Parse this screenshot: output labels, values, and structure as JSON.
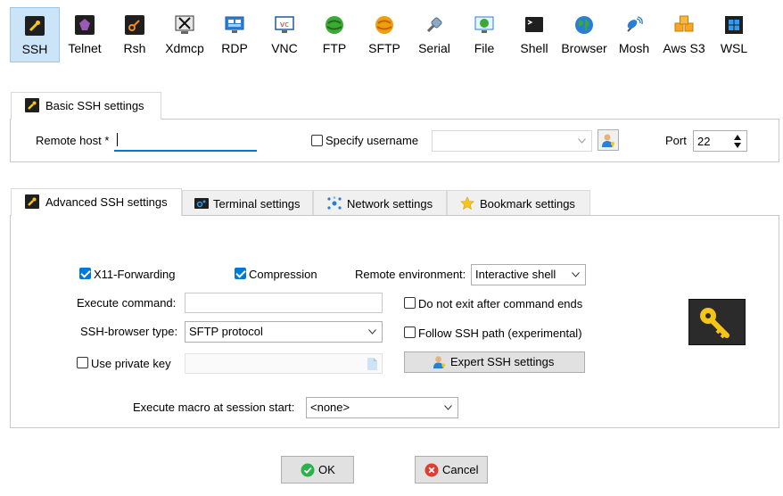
{
  "session_types": [
    {
      "label": "SSH",
      "icon": "ssh-icon",
      "active": true
    },
    {
      "label": "Telnet",
      "icon": "telnet-icon"
    },
    {
      "label": "Rsh",
      "icon": "rsh-icon"
    },
    {
      "label": "Xdmcp",
      "icon": "xdmcp-icon"
    },
    {
      "label": "RDP",
      "icon": "rdp-icon"
    },
    {
      "label": "VNC",
      "icon": "vnc-icon"
    },
    {
      "label": "FTP",
      "icon": "ftp-icon"
    },
    {
      "label": "SFTP",
      "icon": "sftp-icon"
    },
    {
      "label": "Serial",
      "icon": "serial-icon"
    },
    {
      "label": "File",
      "icon": "file-icon"
    },
    {
      "label": "Shell",
      "icon": "shell-icon"
    },
    {
      "label": "Browser",
      "icon": "browser-icon"
    },
    {
      "label": "Mosh",
      "icon": "mosh-icon"
    },
    {
      "label": "Aws S3",
      "icon": "aws-s3-icon"
    },
    {
      "label": "WSL",
      "icon": "wsl-icon"
    }
  ],
  "basic": {
    "tab_label": "Basic SSH settings",
    "remote_host_label": "Remote host *",
    "remote_host_value": "",
    "specify_username_label": "Specify username",
    "specify_username_checked": false,
    "username_value": "",
    "port_label": "Port",
    "port_value": "22"
  },
  "tabs": [
    {
      "label": "Advanced SSH settings",
      "icon": "wrench-icon",
      "selected": true
    },
    {
      "label": "Terminal settings",
      "icon": "terminal-icon"
    },
    {
      "label": "Network settings",
      "icon": "network-icon"
    },
    {
      "label": "Bookmark settings",
      "icon": "star-icon"
    }
  ],
  "advanced": {
    "x11_label": "X11-Forwarding",
    "x11_checked": true,
    "compression_label": "Compression",
    "compression_checked": true,
    "remote_env_label": "Remote environment:",
    "remote_env_value": "Interactive shell",
    "execute_command_label": "Execute command:",
    "execute_command_value": "",
    "do_not_exit_label": "Do not exit after command ends",
    "do_not_exit_checked": false,
    "browser_type_label": "SSH-browser type:",
    "browser_type_value": "SFTP protocol",
    "follow_path_label": "Follow SSH path (experimental)",
    "follow_path_checked": false,
    "private_key_label": "Use private key",
    "private_key_checked": false,
    "private_key_value": "",
    "expert_button_label": "Expert SSH settings",
    "macro_label": "Execute macro at session start:",
    "macro_value": "<none>"
  },
  "buttons": {
    "ok_label": "OK",
    "cancel_label": "Cancel"
  },
  "colors": {
    "accent": "#0078d7",
    "active_tab_bg": "#cce4f7",
    "ok_green": "#2bb24c",
    "cancel_red": "#e03c31",
    "key_yellow": "#f5c518"
  }
}
